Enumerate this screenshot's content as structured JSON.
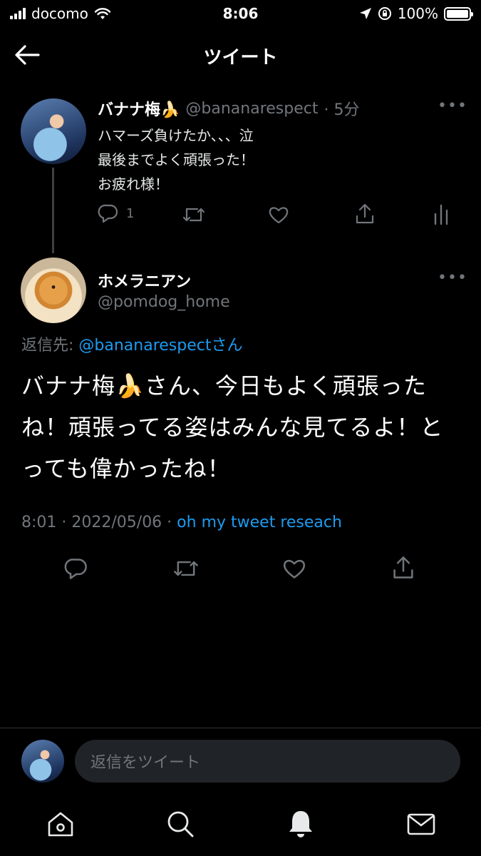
{
  "status_bar": {
    "carrier": "docomo",
    "time": "8:06",
    "battery": "100%",
    "battery_level": 1.0
  },
  "header": {
    "title": "ツイート"
  },
  "original_tweet": {
    "name": "バナナ梅🍌",
    "handle": "@bananarespect",
    "time": "· 5分",
    "text": "ハマーズ負けたか、、、泣\n最後までよく頑張った！\nお疲れ様！",
    "reply_count": "1"
  },
  "reply_tweet": {
    "name": "ホメラニアン",
    "handle": "@pomdog_home",
    "reply_to_label": "返信先: ",
    "reply_to_mention": "@bananarespect",
    "reply_to_suffix": "さん",
    "text": "バナナ梅🍌さん、今日もよく頑張ったね！頑張ってる姿はみんな見てるよ！とっても偉かったね！",
    "timestamp": "8:01 · 2022/05/06 · ",
    "app": "oh my tweet reseach"
  },
  "composer": {
    "placeholder": "返信をツイート"
  },
  "icons": {
    "more": "•••"
  },
  "colors": {
    "background": "#000000",
    "accent": "#1d9bf0",
    "muted": "#71767b"
  }
}
